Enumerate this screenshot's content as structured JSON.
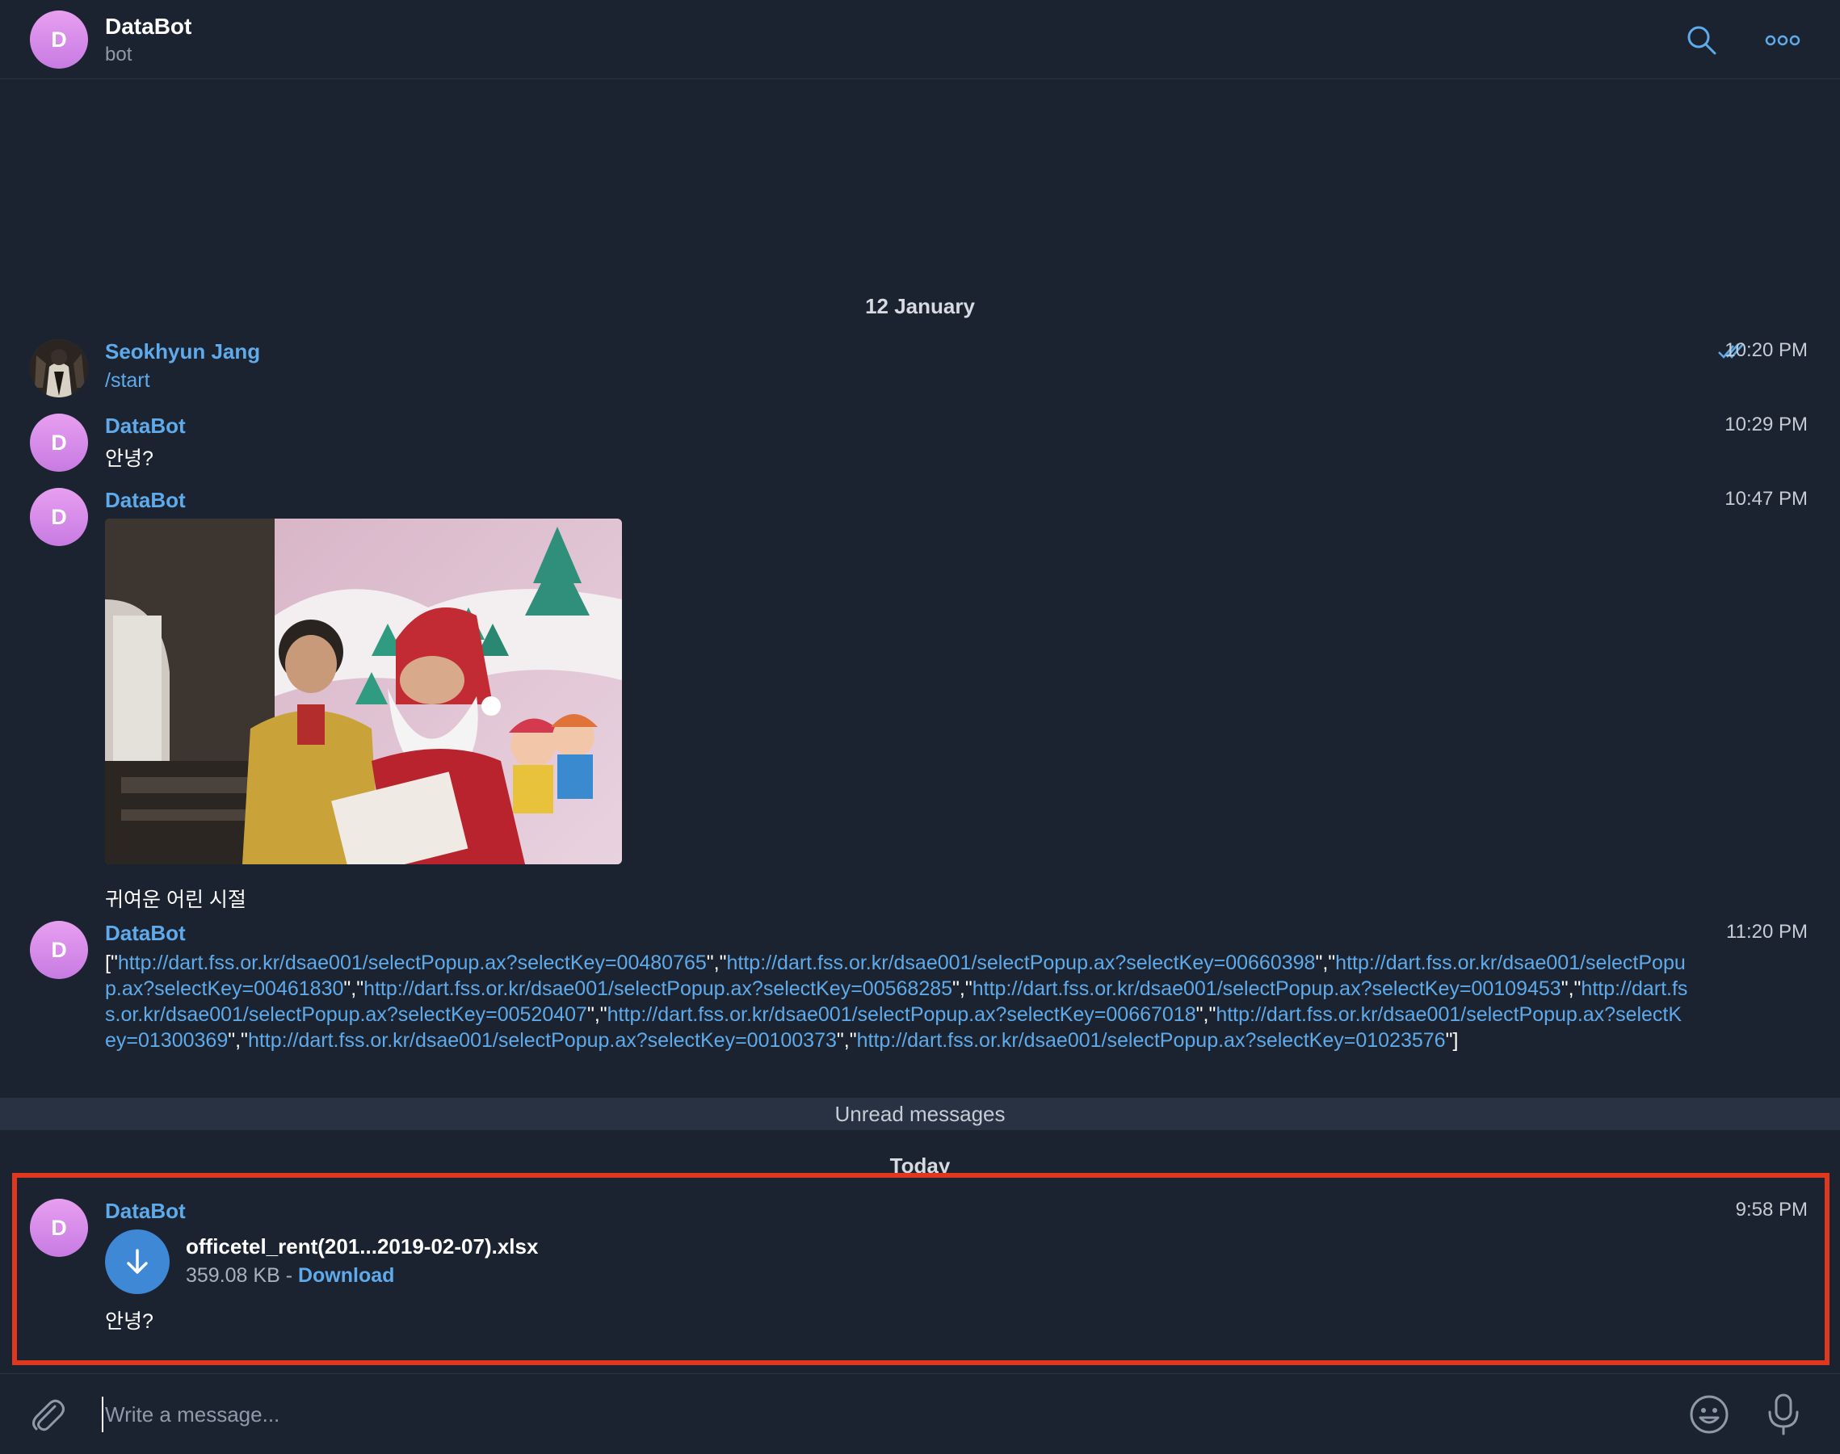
{
  "chat": {
    "title": "DataBot",
    "subtitle": "bot",
    "avatar_letter": "D"
  },
  "date_separators": {
    "earlier": "12 January",
    "today": "Today"
  },
  "messages": [
    {
      "sender": "Seokhyun Jang",
      "text": "/start",
      "time": "10:20 PM"
    },
    {
      "sender": "DataBot",
      "text": "안녕?",
      "time": "10:29 PM"
    },
    {
      "sender": "DataBot",
      "caption": "귀여운 어린 시절",
      "time": "10:47 PM"
    },
    {
      "sender": "DataBot",
      "time": "11:20 PM",
      "links": [
        "http://dart.fss.or.kr/dsae001/selectPopup.ax?selectKey=00480765",
        "http://dart.fss.or.kr/dsae001/selectPopup.ax?selectKey=00660398",
        "http://dart.fss.or.kr/dsae001/selectPopup.ax?selectKey=00461830",
        "http://dart.fss.or.kr/dsae001/selectPopup.ax?selectKey=00568285",
        "http://dart.fss.or.kr/dsae001/selectPopup.ax?selectKey=00109453",
        "http://dart.fss.or.kr/dsae001/selectPopup.ax?selectKey=00520407",
        "http://dart.fss.or.kr/dsae001/selectPopup.ax?selectKey=00667018",
        "http://dart.fss.or.kr/dsae001/selectPopup.ax?selectKey=01300369",
        "http://dart.fss.or.kr/dsae001/selectPopup.ax?selectKey=00100373",
        "http://dart.fss.or.kr/dsae001/selectPopup.ax?selectKey=01023576"
      ]
    },
    {
      "sender": "DataBot",
      "time": "9:58 PM",
      "file_name": "officetel_rent(201...2019-02-07).xlsx",
      "file_size": "359.08 KB",
      "file_sep": " - ",
      "download_label": "Download",
      "text": "안녕?"
    }
  ],
  "unread_label": "Unread messages",
  "composer": {
    "placeholder": "Write a message..."
  },
  "colors": {
    "accent": "#5eaaea",
    "background": "#1c2330",
    "highlight": "#e0381f",
    "download_button": "#3e88d6"
  },
  "icons": {
    "header": [
      "search-icon",
      "more-icon"
    ],
    "composer": [
      "attach-icon",
      "emoji-icon",
      "mic-icon"
    ]
  }
}
